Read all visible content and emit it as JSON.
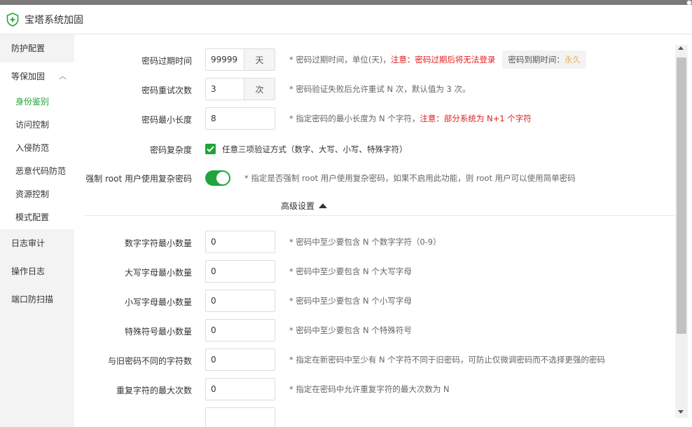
{
  "window": {
    "title": "宝塔系统加固"
  },
  "sidebar": {
    "groups": [
      {
        "label": "防护配置"
      },
      {
        "label": "等保加固"
      },
      {
        "label": "日志审计"
      },
      {
        "label": "操作日志"
      },
      {
        "label": "端口防扫描"
      }
    ],
    "sub_items": [
      {
        "label": "身份鉴别",
        "active": true
      },
      {
        "label": "访问控制"
      },
      {
        "label": "入侵防范"
      },
      {
        "label": "恶意代码防范"
      },
      {
        "label": "资源控制"
      },
      {
        "label": "模式配置"
      }
    ]
  },
  "form": {
    "expire": {
      "label": "密码过期时间",
      "value": "99999",
      "unit": "天",
      "hint": "* 密码过期时间，单位(天)，",
      "warn": "注意：密码过期后将无法登录",
      "status_label": "密码到期时间：",
      "status_value": "永久"
    },
    "retry": {
      "label": "密码重试次数",
      "value": "3",
      "unit": "次",
      "hint": "* 密码验证失败后允许重试 N 次，默认值为 3 次。"
    },
    "min_len": {
      "label": "密码最小长度",
      "value": "8",
      "hint": "* 指定密码的最小长度为 N 个字符，",
      "warn": "注意：部分系统为 N+1 个字符"
    },
    "complexity": {
      "label": "密码复杂度",
      "checkbox_label": "任意三项验证方式（数字、大写、小写、特殊字符）",
      "checked": true
    },
    "root_force": {
      "label": "强制 root 用户使用复杂密码",
      "enabled": true,
      "hint": "* 指定是否强制 root 用户使用复杂密码，如果不启用此功能，则 root 用户可以使用简单密码"
    },
    "advanced_label": "高级设置",
    "advanced": [
      {
        "label": "数字字符最小数量",
        "value": "0",
        "hint": "* 密码中至少要包含 N 个数字字符（0-9）"
      },
      {
        "label": "大写字母最小数量",
        "value": "0",
        "hint": "* 密码中至少要包含 N 个大写字母"
      },
      {
        "label": "小写字母最小数量",
        "value": "0",
        "hint": "* 密码中至少要包含 N 个小写字母"
      },
      {
        "label": "特殊符号最小数量",
        "value": "0",
        "hint": "* 密码中至少要包含 N 个特殊符号"
      },
      {
        "label": "与旧密码不同的字符数",
        "value": "0",
        "hint": "* 指定在新密码中至少有 N 个字符不同于旧密码，可防止仅微调密码而不选择更强的密码"
      },
      {
        "label": "重复字符的最大次数",
        "value": "0",
        "hint": "* 指定在密码中允许重复字符的最大次数为 N"
      }
    ]
  },
  "colors": {
    "accent": "#20a53a",
    "warn": "#e31c1c",
    "status": "#f0ad4e"
  }
}
